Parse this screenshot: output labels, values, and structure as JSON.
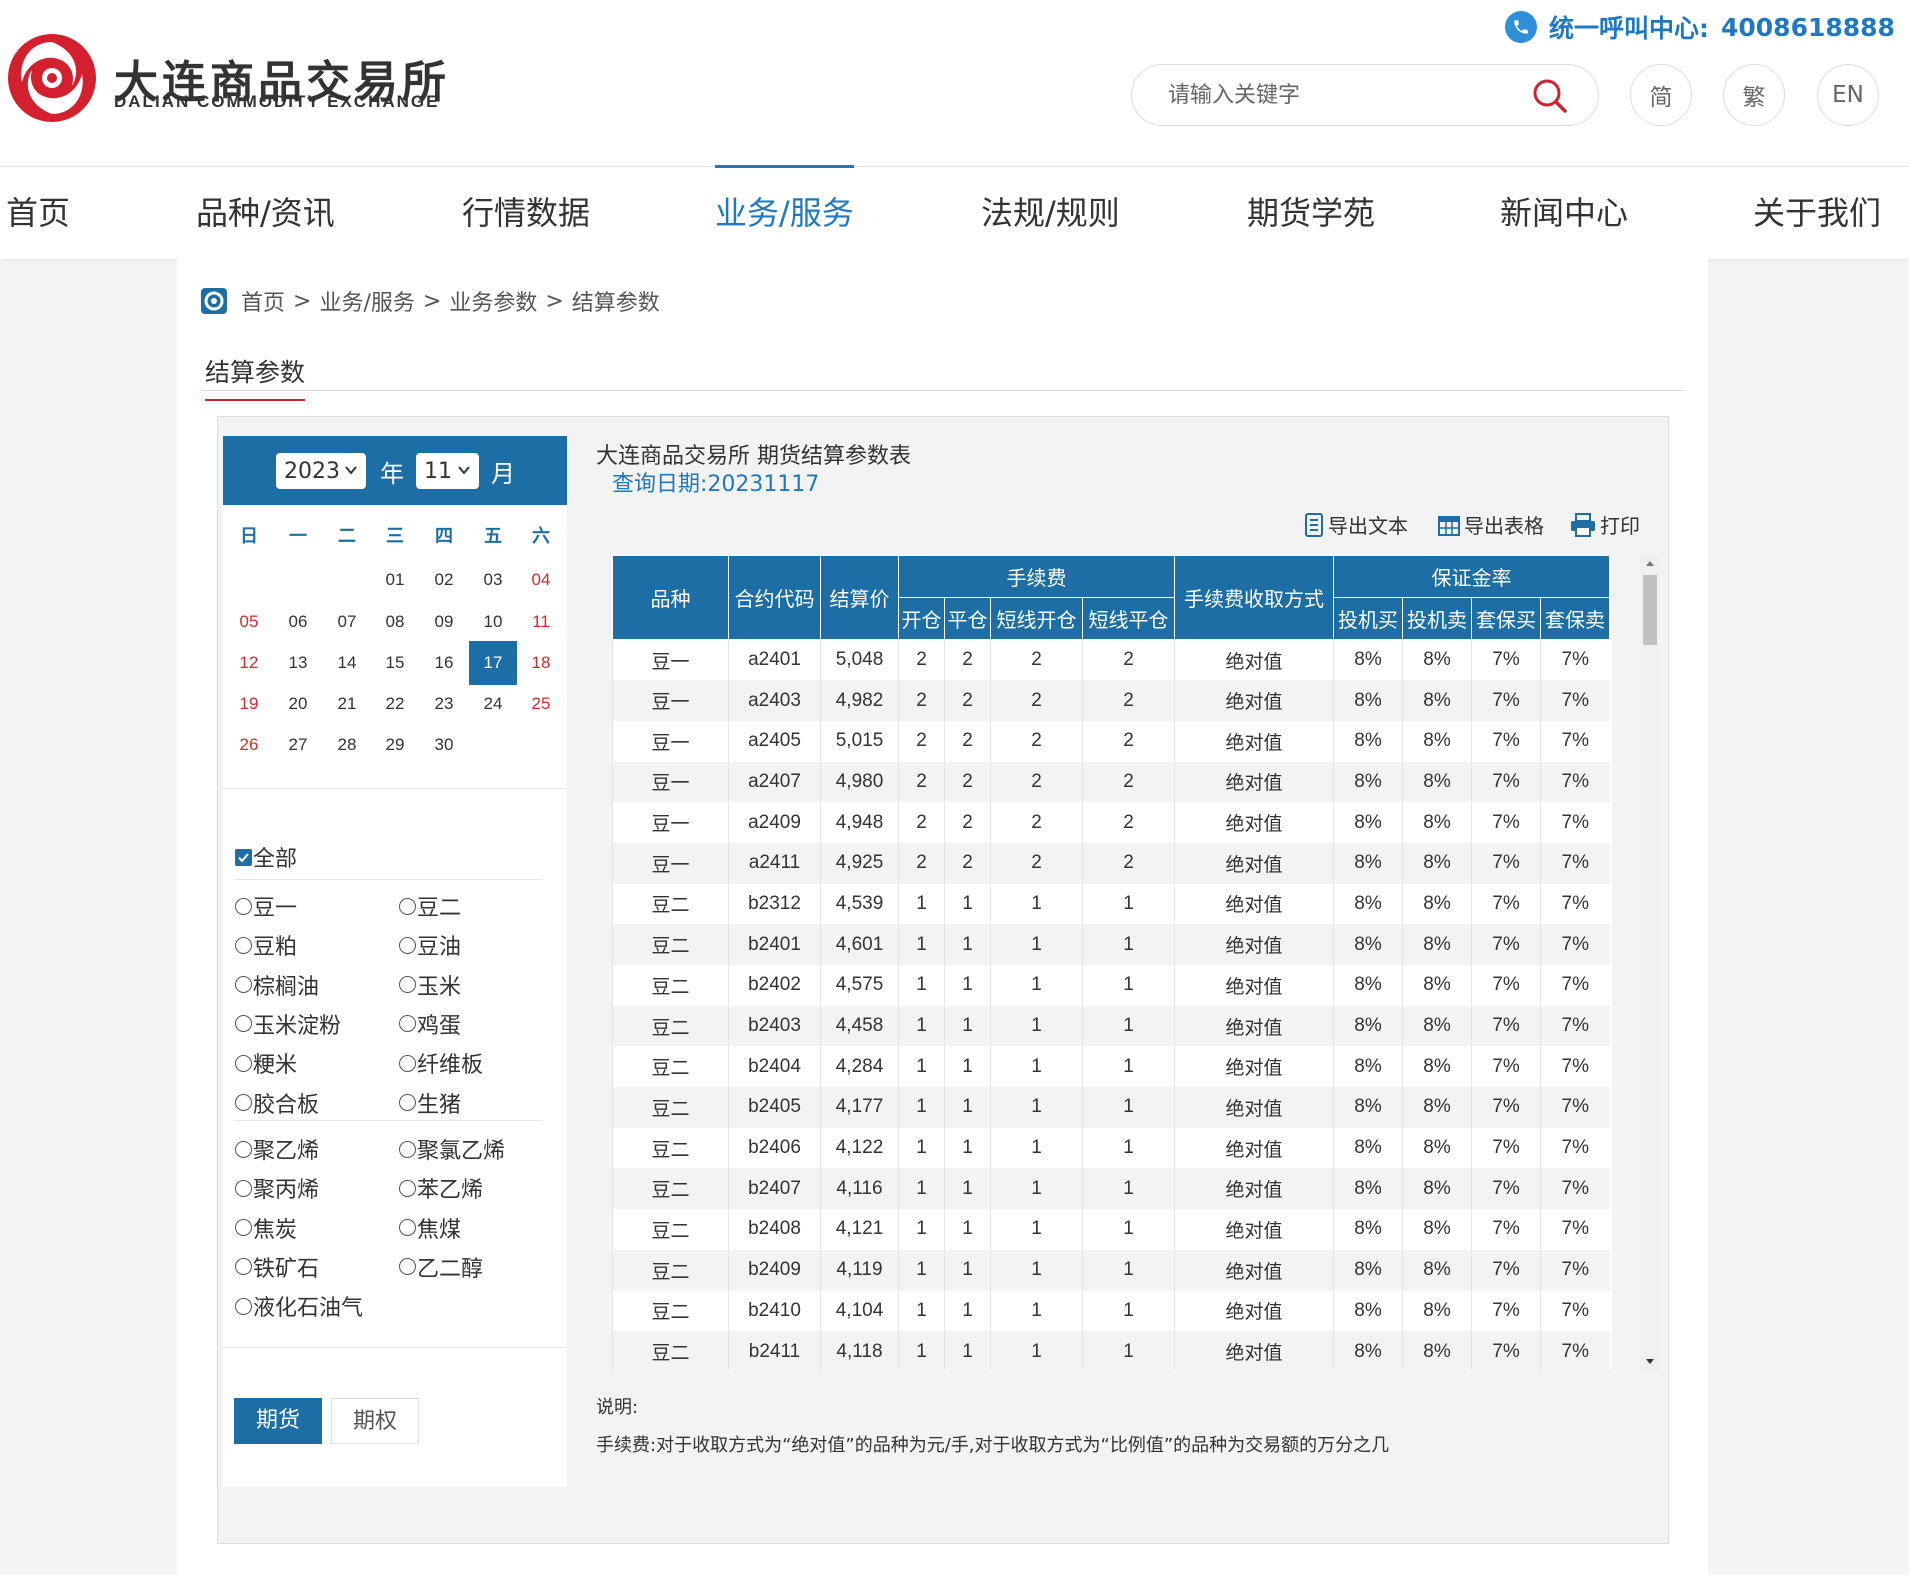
{
  "header": {
    "logo_cn": "大连商品交易所",
    "logo_en": "DALIAN COMMODITY EXCHANGE",
    "hotline_label": "统一呼叫中心:",
    "hotline_number": "4008618888",
    "search_placeholder": "请输入关键字",
    "lang": [
      "简",
      "繁",
      "EN"
    ]
  },
  "nav": [
    "首页",
    "品种/资讯",
    "行情数据",
    "业务/服务",
    "法规/规则",
    "期货学苑",
    "新闻中心",
    "关于我们"
  ],
  "nav_active": "业务/服务",
  "breadcrumb": [
    "首页",
    "业务/服务",
    "业务参数",
    "结算参数"
  ],
  "breadcrumb_sep": ">",
  "page_title": "结算参数",
  "calendar": {
    "year": "2023",
    "year_unit": "年",
    "month": "11",
    "month_unit": "月",
    "weekdays": [
      "日",
      "一",
      "二",
      "三",
      "四",
      "五",
      "六"
    ],
    "days": [
      "01",
      "02",
      "03",
      "04",
      "05",
      "06",
      "07",
      "08",
      "09",
      "10",
      "11",
      "12",
      "13",
      "14",
      "15",
      "16",
      "17",
      "18",
      "19",
      "20",
      "21",
      "22",
      "23",
      "24",
      "25",
      "26",
      "27",
      "28",
      "29",
      "30"
    ],
    "selected_day": "17"
  },
  "filters": {
    "all_label": "全部",
    "group1": [
      "豆一",
      "豆二",
      "豆粕",
      "豆油",
      "棕榈油",
      "玉米",
      "玉米淀粉",
      "鸡蛋",
      "粳米",
      "纤维板",
      "胶合板",
      "生猪"
    ],
    "group2": [
      "聚乙烯",
      "聚氯乙烯",
      "聚丙烯",
      "苯乙烯",
      "焦炭",
      "焦煤",
      "铁矿石",
      "乙二醇",
      "液化石油气"
    ]
  },
  "type_buttons": [
    "期货",
    "期权"
  ],
  "content": {
    "title": "大连商品交易所 期货结算参数表",
    "query_date": "查询日期:20231117",
    "tools": [
      "导出文本",
      "导出表格",
      "打印"
    ]
  },
  "table": {
    "group_headers": {
      "fee": "手续费",
      "margin": "保证金率"
    },
    "headers": {
      "variety": "品种",
      "code": "合约代码",
      "price": "结算价",
      "open": "开仓",
      "close": "平仓",
      "short_open": "短线开仓",
      "short_close": "短线平仓",
      "fee_method": "手续费收取方式",
      "spec_buy": "投机买",
      "spec_sell": "投机卖",
      "hedge_buy": "套保买",
      "hedge_sell": "套保卖"
    },
    "rows": [
      [
        "豆一",
        "a2401",
        "5,048",
        "2",
        "2",
        "2",
        "2",
        "绝对值",
        "8%",
        "8%",
        "7%",
        "7%"
      ],
      [
        "豆一",
        "a2403",
        "4,982",
        "2",
        "2",
        "2",
        "2",
        "绝对值",
        "8%",
        "8%",
        "7%",
        "7%"
      ],
      [
        "豆一",
        "a2405",
        "5,015",
        "2",
        "2",
        "2",
        "2",
        "绝对值",
        "8%",
        "8%",
        "7%",
        "7%"
      ],
      [
        "豆一",
        "a2407",
        "4,980",
        "2",
        "2",
        "2",
        "2",
        "绝对值",
        "8%",
        "8%",
        "7%",
        "7%"
      ],
      [
        "豆一",
        "a2409",
        "4,948",
        "2",
        "2",
        "2",
        "2",
        "绝对值",
        "8%",
        "8%",
        "7%",
        "7%"
      ],
      [
        "豆一",
        "a2411",
        "4,925",
        "2",
        "2",
        "2",
        "2",
        "绝对值",
        "8%",
        "8%",
        "7%",
        "7%"
      ],
      [
        "豆二",
        "b2312",
        "4,539",
        "1",
        "1",
        "1",
        "1",
        "绝对值",
        "8%",
        "8%",
        "7%",
        "7%"
      ],
      [
        "豆二",
        "b2401",
        "4,601",
        "1",
        "1",
        "1",
        "1",
        "绝对值",
        "8%",
        "8%",
        "7%",
        "7%"
      ],
      [
        "豆二",
        "b2402",
        "4,575",
        "1",
        "1",
        "1",
        "1",
        "绝对值",
        "8%",
        "8%",
        "7%",
        "7%"
      ],
      [
        "豆二",
        "b2403",
        "4,458",
        "1",
        "1",
        "1",
        "1",
        "绝对值",
        "8%",
        "8%",
        "7%",
        "7%"
      ],
      [
        "豆二",
        "b2404",
        "4,284",
        "1",
        "1",
        "1",
        "1",
        "绝对值",
        "8%",
        "8%",
        "7%",
        "7%"
      ],
      [
        "豆二",
        "b2405",
        "4,177",
        "1",
        "1",
        "1",
        "1",
        "绝对值",
        "8%",
        "8%",
        "7%",
        "7%"
      ],
      [
        "豆二",
        "b2406",
        "4,122",
        "1",
        "1",
        "1",
        "1",
        "绝对值",
        "8%",
        "8%",
        "7%",
        "7%"
      ],
      [
        "豆二",
        "b2407",
        "4,116",
        "1",
        "1",
        "1",
        "1",
        "绝对值",
        "8%",
        "8%",
        "7%",
        "7%"
      ],
      [
        "豆二",
        "b2408",
        "4,121",
        "1",
        "1",
        "1",
        "1",
        "绝对值",
        "8%",
        "8%",
        "7%",
        "7%"
      ],
      [
        "豆二",
        "b2409",
        "4,119",
        "1",
        "1",
        "1",
        "1",
        "绝对值",
        "8%",
        "8%",
        "7%",
        "7%"
      ],
      [
        "豆二",
        "b2410",
        "4,104",
        "1",
        "1",
        "1",
        "1",
        "绝对值",
        "8%",
        "8%",
        "7%",
        "7%"
      ],
      [
        "豆二",
        "b2411",
        "4,118",
        "1",
        "1",
        "1",
        "1",
        "绝对值",
        "8%",
        "8%",
        "7%",
        "7%"
      ]
    ]
  },
  "note": {
    "title": "说明:",
    "body": "手续费:对于收取方式为“绝对值”的品种为元/手,对于收取方式为“比例值”的品种为交易额的万分之几"
  },
  "colors": {
    "primary": "#1c6ea4",
    "accent_blue": "#1e78c2",
    "weekend_red": "#d42a2a",
    "brand_red": "#c9242f"
  }
}
